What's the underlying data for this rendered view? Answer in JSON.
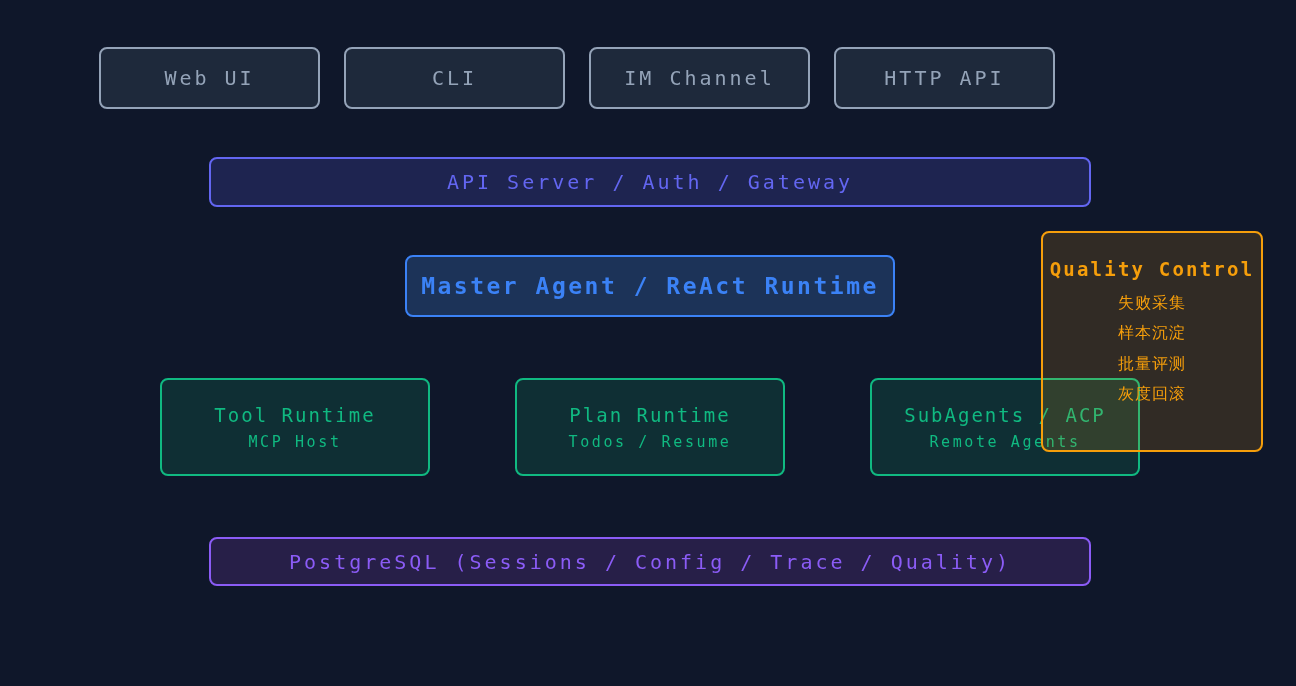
{
  "clients": [
    {
      "label": "Web UI"
    },
    {
      "label": "CLI"
    },
    {
      "label": "IM Channel"
    },
    {
      "label": "HTTP API"
    }
  ],
  "gateway": {
    "label": "API Server / Auth / Gateway"
  },
  "master": {
    "label": "Master Agent / ReAct Runtime"
  },
  "runtimes": [
    {
      "title": "Tool Runtime",
      "subtitle": "MCP Host"
    },
    {
      "title": "Plan Runtime",
      "subtitle": "Todos / Resume"
    },
    {
      "title": "SubAgents / ACP",
      "subtitle": "Remote Agents"
    }
  ],
  "storage": {
    "label": "PostgreSQL (Sessions / Config / Trace / Quality)"
  },
  "quality": {
    "title": "Quality Control",
    "items": [
      "失败采集",
      "样本沉淀",
      "批量评测",
      "灰度回滚"
    ]
  }
}
